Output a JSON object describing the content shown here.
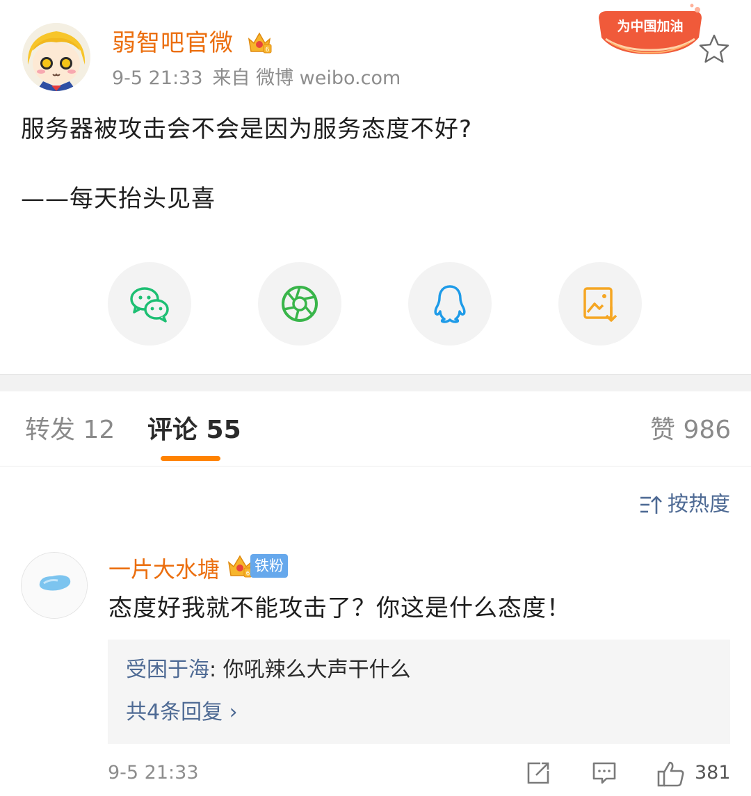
{
  "post": {
    "username": "弱智吧官微",
    "time": "9-5 21:33",
    "source": "来自 微博 weibo.com",
    "badge_text": "为中国加油",
    "text_line1": "服务器被攻击会不会是因为服务态度不好?",
    "text_line2": "——每天抬头见喜"
  },
  "share": {
    "items": [
      {
        "icon": "wechat-icon",
        "color": "#1dbf73"
      },
      {
        "icon": "moments-icon",
        "color": "#39b54a"
      },
      {
        "icon": "qq-icon",
        "color": "#1e9be8"
      },
      {
        "icon": "save-image-icon",
        "color": "#f5a623"
      }
    ]
  },
  "tabs": {
    "repost": "转发 12",
    "comment": "评论 55",
    "like": "赞 986",
    "accent": "#ff8200"
  },
  "sort": {
    "label": "按热度"
  },
  "comment": {
    "username": "一片大水塘",
    "fan_badge": "铁粉",
    "text": "态度好我就不能攻击了？你这是什么态度！",
    "reply_user": "受困于海",
    "reply_text": ": 你吼辣么大声干什么",
    "more_replies": "共4条回复 ›",
    "time": "9-5 21:33",
    "likes": "381"
  },
  "colors": {
    "username": "#eb6e0e",
    "link": "#4e6a94",
    "muted": "#8d8d8d"
  }
}
